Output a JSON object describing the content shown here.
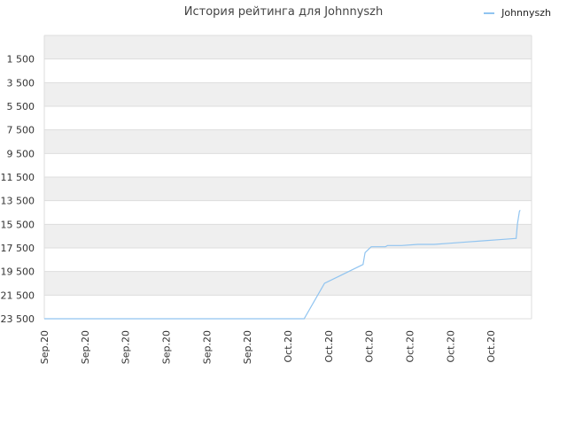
{
  "chart_data": {
    "type": "line",
    "title": "История рейтинга для Johnnyszh",
    "xlabel": "",
    "ylabel": "",
    "legend_position": "top-right",
    "y_inverted": true,
    "ylim": [
      -500,
      23500
    ],
    "y_ticks": [
      1500,
      3500,
      5500,
      7500,
      9500,
      11500,
      13500,
      15500,
      17500,
      19500,
      21500,
      23500
    ],
    "y_tick_labels": [
      "1 500",
      "3 500",
      "5 500",
      "7 500",
      "9 500",
      "11 500",
      "13 500",
      "15 500",
      "17 500",
      "19 500",
      "21 500",
      "23 500"
    ],
    "x_tick_labels": [
      "Sep.20",
      "Sep.20",
      "Sep.20",
      "Sep.20",
      "Sep.20",
      "Sep.20",
      "Oct.20",
      "Oct.20",
      "Oct.20",
      "Oct.20",
      "Oct.20",
      "Oct.20"
    ],
    "x_range": [
      0,
      12
    ],
    "grid": true,
    "series": [
      {
        "name": "Johnnyszh",
        "color": "#90c4f0",
        "x": [
          0,
          6.4,
          6.9,
          7.85,
          7.87,
          7.9,
          8.05,
          8.2,
          8.4,
          8.45,
          8.8,
          9.2,
          9.6,
          10.0,
          10.4,
          10.8,
          11.2,
          11.6,
          11.62,
          11.65,
          11.7,
          11.72
        ],
        "y": [
          23500,
          23500,
          20500,
          18900,
          18500,
          17900,
          17400,
          17400,
          17400,
          17300,
          17300,
          17200,
          17200,
          17100,
          17000,
          16900,
          16800,
          16700,
          16700,
          15500,
          14400,
          14300
        ]
      }
    ]
  }
}
